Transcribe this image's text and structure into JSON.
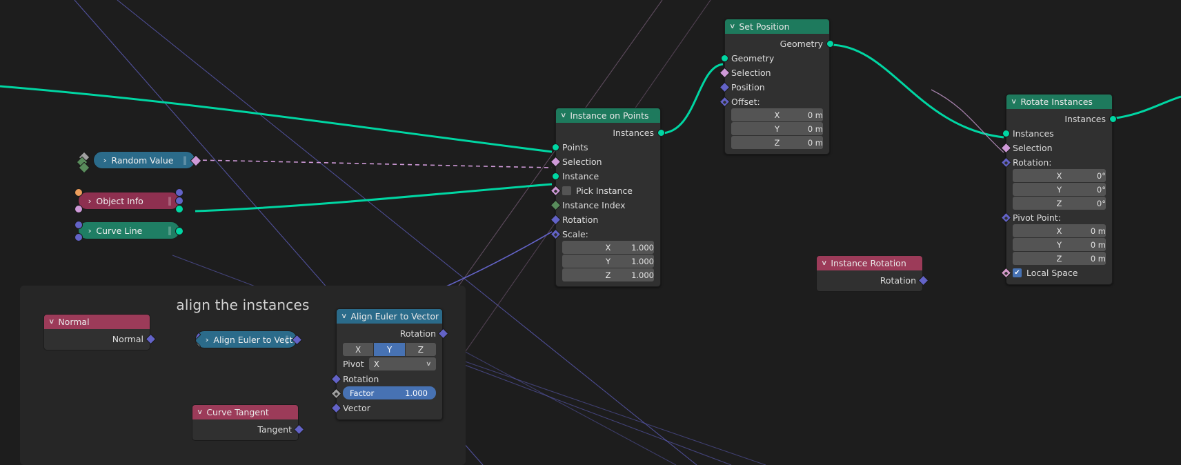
{
  "app": {
    "editor": "geometry-node-editor"
  },
  "frame": {
    "label": "align the instances"
  },
  "colors": {
    "geometry_socket": "#00d6a3",
    "boolean_socket": "#cf9ad8",
    "vector_socket": "#6363c7",
    "integer_socket": "#598c5c",
    "float_socket": "#a1a1a1",
    "object_socket": "#ed9e5c",
    "header_geometry": "#1e7a5d",
    "header_vector": "#2b6b8a",
    "header_input": "#8e3050",
    "accent_blue": "#4772b3",
    "wire_geometry": "#00d6a3",
    "wire_field": "#6363c7",
    "wire_boolean": "#cf9ad8"
  },
  "nodes": {
    "random_value": {
      "title": "Random Value",
      "collapsed": true,
      "chevron": "›",
      "grip": "‖"
    },
    "object_info": {
      "title": "Object Info",
      "collapsed": true,
      "chevron": "›",
      "grip": "‖"
    },
    "curve_line": {
      "title": "Curve Line",
      "collapsed": true,
      "chevron": "›",
      "grip": "‖"
    },
    "instance_on_points": {
      "title": "Instance on Points",
      "chevron": "∨",
      "outputs": [
        {
          "label": "Instances",
          "socket": "geometry"
        }
      ],
      "inputs": [
        {
          "label": "Points",
          "socket": "geometry"
        },
        {
          "label": "Selection",
          "socket": "boolean"
        },
        {
          "label": "Instance",
          "socket": "geometry"
        },
        {
          "label": "Pick Instance",
          "socket": "boolean",
          "checkbox": true,
          "checked": false
        },
        {
          "label": "Instance Index",
          "socket": "integer"
        },
        {
          "label": "Rotation",
          "socket": "vector"
        },
        {
          "label": "Scale:",
          "socket": "vector"
        }
      ],
      "scale_fields": [
        {
          "axis": "X",
          "value": "1.000"
        },
        {
          "axis": "Y",
          "value": "1.000"
        },
        {
          "axis": "Z",
          "value": "1.000"
        }
      ]
    },
    "set_position": {
      "title": "Set Position",
      "chevron": "∨",
      "outputs": [
        {
          "label": "Geometry",
          "socket": "geometry"
        }
      ],
      "inputs": [
        {
          "label": "Geometry",
          "socket": "geometry"
        },
        {
          "label": "Selection",
          "socket": "boolean"
        },
        {
          "label": "Position",
          "socket": "vector"
        },
        {
          "label": "Offset:",
          "socket": "vector"
        }
      ],
      "offset_fields": [
        {
          "axis": "X",
          "value": "0 m"
        },
        {
          "axis": "Y",
          "value": "0 m"
        },
        {
          "axis": "Z",
          "value": "0 m"
        }
      ]
    },
    "rotate_instances": {
      "title": "Rotate Instances",
      "chevron": "∨",
      "outputs": [
        {
          "label": "Instances",
          "socket": "geometry"
        }
      ],
      "inputs": [
        {
          "label": "Instances",
          "socket": "geometry"
        },
        {
          "label": "Selection",
          "socket": "boolean"
        },
        {
          "label": "Rotation:",
          "socket": "vector"
        }
      ],
      "rotation_fields": [
        {
          "axis": "X",
          "value": "0°"
        },
        {
          "axis": "Y",
          "value": "0°"
        },
        {
          "axis": "Z",
          "value": "0°"
        }
      ],
      "pivot_label": "Pivot Point:",
      "pivot_fields": [
        {
          "axis": "X",
          "value": "0 m"
        },
        {
          "axis": "Y",
          "value": "0 m"
        },
        {
          "axis": "Z",
          "value": "0 m"
        }
      ],
      "local_space": {
        "label": "Local Space",
        "checked": true,
        "check_glyph": "✔"
      }
    },
    "instance_rotation": {
      "title": "Instance Rotation",
      "chevron": "∨",
      "outputs": [
        {
          "label": "Rotation",
          "socket": "vector"
        }
      ]
    },
    "normal": {
      "title": "Normal",
      "chevron": "∨",
      "outputs": [
        {
          "label": "Normal",
          "socket": "vector"
        }
      ]
    },
    "curve_tangent": {
      "title": "Curve Tangent",
      "chevron": "∨",
      "outputs": [
        {
          "label": "Tangent",
          "socket": "vector"
        }
      ]
    },
    "align_euler_to_vector_collapsed": {
      "title": "Align Euler to Vector",
      "collapsed": true,
      "chevron": "›",
      "grip": "‖"
    },
    "align_euler_to_vector": {
      "title": "Align Euler to Vector",
      "chevron": "∨",
      "outputs": [
        {
          "label": "Rotation",
          "socket": "vector"
        }
      ],
      "axis_toggle": {
        "options": [
          "X",
          "Y",
          "Z"
        ],
        "selected": "Y"
      },
      "pivot": {
        "label": "Pivot",
        "value": "X",
        "chevron": "∨"
      },
      "inputs": [
        {
          "label": "Rotation",
          "socket": "vector"
        },
        {
          "label": "Vector",
          "socket": "vector"
        }
      ],
      "factor": {
        "label": "Factor",
        "value": "1.000",
        "socket": "float"
      }
    }
  }
}
